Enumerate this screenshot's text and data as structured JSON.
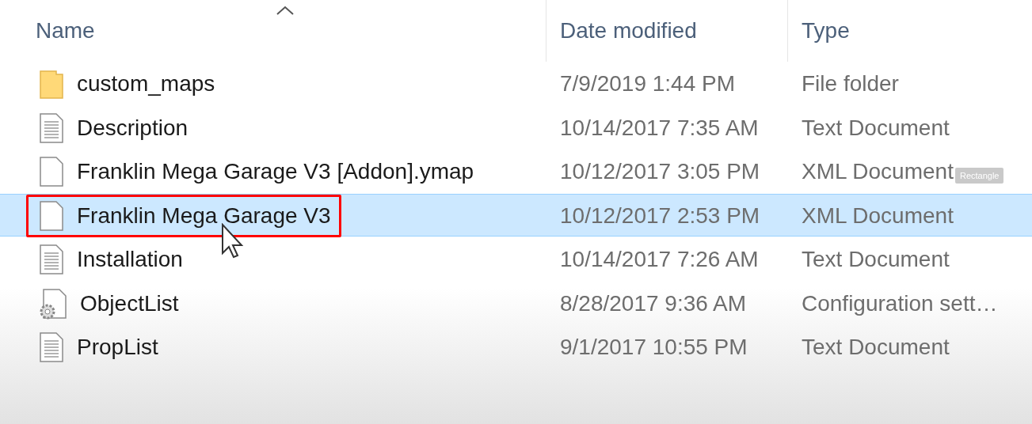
{
  "columns": [
    {
      "label": "Name",
      "sorted": true
    },
    {
      "label": "Date modified",
      "sorted": false
    },
    {
      "label": "Type",
      "sorted": false
    }
  ],
  "rows": [
    {
      "kind": "folder",
      "name": "custom_maps",
      "date": "7/9/2019 1:44 PM",
      "type": "File folder",
      "selected": false,
      "highlighted": false
    },
    {
      "kind": "text",
      "name": "Description",
      "date": "10/14/2017 7:35 AM",
      "type": "Text Document",
      "selected": false,
      "highlighted": false
    },
    {
      "kind": "blank",
      "name": "Franklin Mega Garage V3 [Addon].ymap",
      "date": "10/12/2017 3:05 PM",
      "type": "XML Document",
      "selected": false,
      "highlighted": false,
      "tag": "Rectangle"
    },
    {
      "kind": "blank",
      "name": "Franklin Mega Garage V3",
      "date": "10/12/2017 2:53 PM",
      "type": "XML Document",
      "selected": true,
      "highlighted": true
    },
    {
      "kind": "text",
      "name": "Installation",
      "date": "10/14/2017 7:26 AM",
      "type": "Text Document",
      "selected": false,
      "highlighted": false
    },
    {
      "kind": "config",
      "name": "ObjectList",
      "date": "8/28/2017 9:36 AM",
      "type": "Configuration sett…",
      "selected": false,
      "highlighted": false
    },
    {
      "kind": "text",
      "name": "PropList",
      "date": "9/1/2017 10:55 PM",
      "type": "Text Document",
      "selected": false,
      "highlighted": false
    }
  ]
}
